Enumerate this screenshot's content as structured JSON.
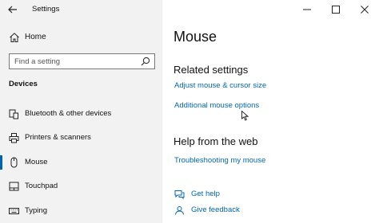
{
  "window": {
    "title": "Settings",
    "controls": [
      "minimize-icon",
      "maximize-icon",
      "close-icon"
    ]
  },
  "sidebar": {
    "home_label": "Home",
    "search_placeholder": "Find a setting",
    "section": "Devices",
    "items": [
      {
        "label": "Bluetooth & other devices",
        "icon": "bluetooth-devices-icon"
      },
      {
        "label": "Printers & scanners",
        "icon": "printer-icon"
      },
      {
        "label": "Mouse",
        "icon": "mouse-icon",
        "selected": true
      },
      {
        "label": "Touchpad",
        "icon": "touchpad-icon"
      },
      {
        "label": "Typing",
        "icon": "keyboard-icon"
      }
    ]
  },
  "main": {
    "title": "Mouse",
    "related_heading": "Related settings",
    "related_links": [
      "Adjust mouse & cursor size",
      "Additional mouse options"
    ],
    "help_heading": "Help from the web",
    "help_links": [
      "Troubleshooting my mouse"
    ],
    "support_links": [
      {
        "label": "Get help",
        "icon": "help-chat-icon"
      },
      {
        "label": "Give feedback",
        "icon": "feedback-icon"
      }
    ]
  },
  "colors": {
    "accent": "#0067b8",
    "selection_bar": "#0063b1",
    "sidebar_bg": "#f2f2f2"
  }
}
